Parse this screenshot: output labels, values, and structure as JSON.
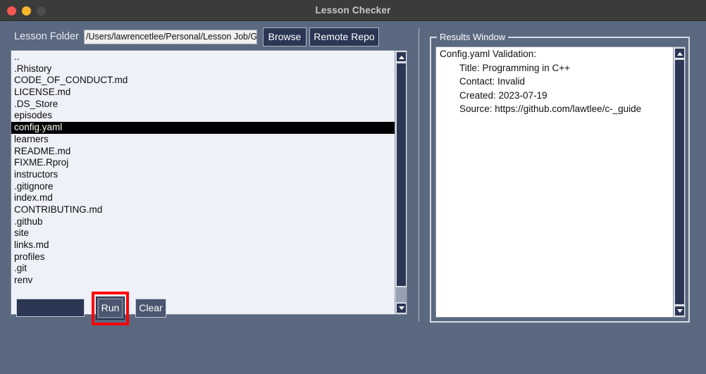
{
  "window": {
    "title": "Lesson Checker",
    "traffic_lights": [
      {
        "name": "close",
        "color": "#f5564f"
      },
      {
        "name": "minimize",
        "color": "#f9b52a"
      },
      {
        "name": "maximize",
        "color": "#4d4d4d"
      }
    ]
  },
  "theme": {
    "background": "#5a6880",
    "titlebar": "#3b3b3b",
    "button_face": "#2b3654",
    "highlight_box": "#ff0000",
    "list_background": "#eef1f7",
    "selection_background": "#000000",
    "selection_text": "#ffffff"
  },
  "toolbar": {
    "folder_label": "Lesson Folder",
    "path_value": "/Users/lawrencetlee/Personal/Lesson Job/Guides/c-",
    "path_placeholder": "",
    "browse_label": "Browse",
    "remote_repo_label": "Remote Repo"
  },
  "file_list": {
    "selected_index": 6,
    "items": [
      "..",
      ".Rhistory",
      "CODE_OF_CONDUCT.md",
      "LICENSE.md",
      ".DS_Store",
      "episodes",
      "config.yaml",
      "learners",
      "README.md",
      "FIXME.Rproj",
      "instructors",
      ".gitignore",
      "index.md",
      "CONTRIBUTING.md",
      ".github",
      "site",
      "links.md",
      "profiles",
      ".git",
      "renv"
    ]
  },
  "actions": {
    "blank_label": "",
    "run_label": "Run",
    "clear_label": "Clear"
  },
  "results": {
    "legend": "Results Window",
    "lines": [
      {
        "text": "Config.yaml Validation:",
        "indent": false
      },
      {
        "text": "Title: Programming in C++",
        "indent": true
      },
      {
        "text": "Contact: Invalid",
        "indent": true
      },
      {
        "text": "Created: 2023-07-19",
        "indent": true
      },
      {
        "text": "Source: https://github.com/lawtlee/c-_guide",
        "indent": true
      }
    ]
  }
}
